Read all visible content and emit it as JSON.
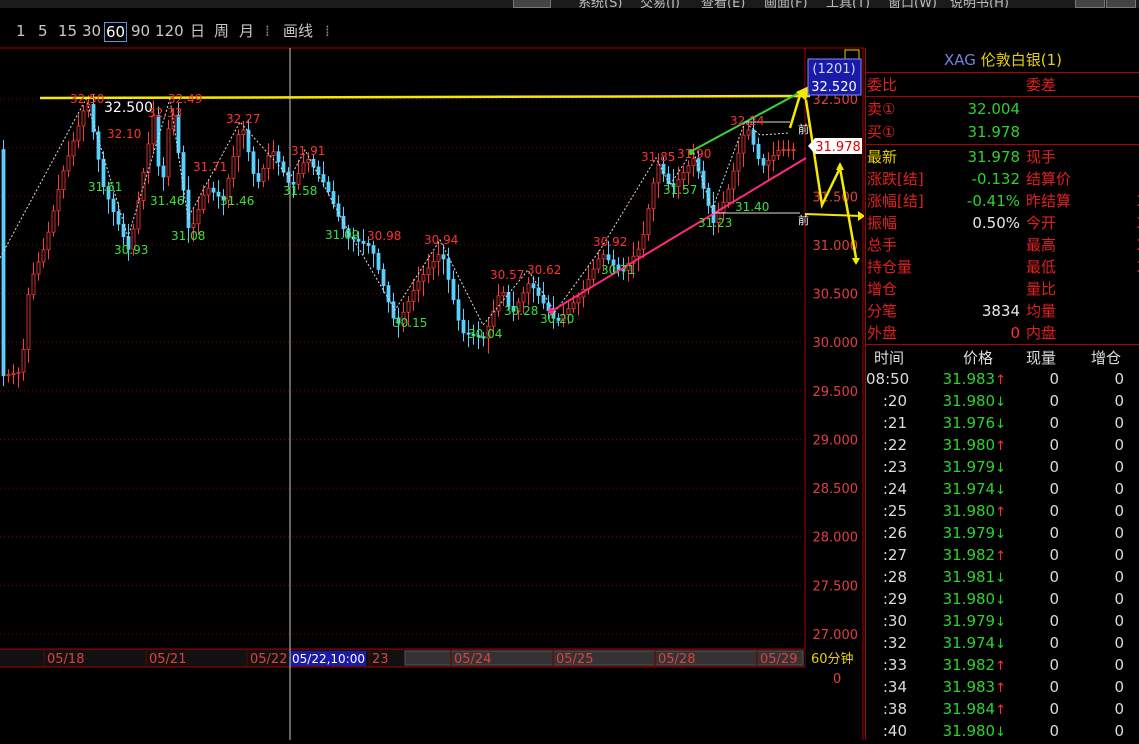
{
  "menu": {
    "items": [
      "系统(S)",
      "交易(J)",
      "查看(E)",
      "画面(F)",
      "工具(T)",
      "窗口(W)",
      "说明书(H)"
    ]
  },
  "toolbar": {
    "periods": [
      "1",
      "5",
      "15",
      "30",
      "60",
      "90",
      "120",
      "日",
      "周",
      "月"
    ],
    "selected": "60",
    "draw_label": "画线"
  },
  "chart": {
    "timeframe_label": "60分钟",
    "cursor_label": "05/22,10:00",
    "cursor_value_label": "(1201)",
    "cursor_price_label": "32.520",
    "last_price_label": "31.978",
    "y_ticks": [
      "32.500",
      "32.000",
      "31.500",
      "31.000",
      "30.500",
      "30.000",
      "29.500",
      "29.000",
      "28.500",
      "28.000",
      "27.500",
      "27.000"
    ],
    "x_ticks": [
      "05/18",
      "05/21",
      "05/22",
      "23",
      "05/24",
      "05/25",
      "05/28",
      "05/29"
    ],
    "volume_axis_label": "0",
    "resistance_label": "32.500",
    "peak_labels": [
      "32.50",
      "32.49",
      "32.33",
      "32.10",
      "32.27",
      "31.91",
      "31.71",
      "30.98",
      "30.94",
      "30.57",
      "30.62",
      "30.92",
      "31.85",
      "31.90",
      "32.24"
    ],
    "trough_labels": [
      "31.61",
      "30.93",
      "31.46",
      "31.08",
      "31.46",
      "31.58",
      "31.09",
      "30.15",
      "30.04",
      "30.28",
      "30.20",
      "30.71",
      "31.57",
      "31.23",
      "31.40"
    ],
    "misc_marks": [
      "前",
      "前"
    ],
    "colors": {
      "up": "#ff3b3b",
      "down": "#5bd0ff",
      "grid": "#7a0000",
      "green_line": "#3ad23a",
      "pink_line": "#ff2a80",
      "yellow": "#f2ea00"
    }
  },
  "quote": {
    "symbol": "XAG",
    "name": "伦敦白银",
    "suffix": "(1)",
    "wei_bi_label": "委比",
    "wei_cha_label": "委差",
    "sell_label": "卖①",
    "sell_value": "32.004",
    "buy_label": "买①",
    "buy_value": "31.978",
    "rows": [
      {
        "l1": "最新",
        "v1": "31.978",
        "l2": "现手",
        "v2": ""
      },
      {
        "l1": "涨跌[结]",
        "v1": "-0.132",
        "l2": "结算价",
        "v2": ""
      },
      {
        "l1": "涨幅[结]",
        "v1": "-0.41%",
        "l2": "昨结算",
        "v2": "3"
      },
      {
        "l1": "振幅",
        "v1": "0.50%",
        "l2": "今开",
        "v2": "3"
      },
      {
        "l1": "总手",
        "v1": "",
        "l2": "最高",
        "v2": "3"
      },
      {
        "l1": "持仓量",
        "v1": "",
        "l2": "最低",
        "v2": "3"
      },
      {
        "l1": "增仓",
        "v1": "",
        "l2": "量比",
        "v2": ""
      },
      {
        "l1": "分笔",
        "v1": "3834",
        "l2": "均量",
        "v2": ""
      },
      {
        "l1": "外盘",
        "v1": "0",
        "l2": "内盘",
        "v2": ""
      }
    ]
  },
  "ticks": {
    "headers": [
      "时间",
      "价格",
      "现量",
      "增仓"
    ],
    "rows": [
      {
        "time": "08:50",
        "price": "31.983",
        "dir": "up",
        "vol": "0",
        "oi": "0"
      },
      {
        "time": ":20",
        "price": "31.980",
        "dir": "down",
        "vol": "0",
        "oi": "0"
      },
      {
        "time": ":21",
        "price": "31.976",
        "dir": "down",
        "vol": "0",
        "oi": "0"
      },
      {
        "time": ":22",
        "price": "31.980",
        "dir": "up",
        "vol": "0",
        "oi": "0"
      },
      {
        "time": ":23",
        "price": "31.979",
        "dir": "down",
        "vol": "0",
        "oi": "0"
      },
      {
        "time": ":24",
        "price": "31.974",
        "dir": "down",
        "vol": "0",
        "oi": "0"
      },
      {
        "time": ":25",
        "price": "31.980",
        "dir": "up",
        "vol": "0",
        "oi": "0"
      },
      {
        "time": ":26",
        "price": "31.979",
        "dir": "down",
        "vol": "0",
        "oi": "0"
      },
      {
        "time": ":27",
        "price": "31.982",
        "dir": "up",
        "vol": "0",
        "oi": "0"
      },
      {
        "time": ":28",
        "price": "31.981",
        "dir": "down",
        "vol": "0",
        "oi": "0"
      },
      {
        "time": ":29",
        "price": "31.980",
        "dir": "down",
        "vol": "0",
        "oi": "0"
      },
      {
        "time": ":30",
        "price": "31.979",
        "dir": "down",
        "vol": "0",
        "oi": "0"
      },
      {
        "time": ":32",
        "price": "31.974",
        "dir": "down",
        "vol": "0",
        "oi": "0"
      },
      {
        "time": ":33",
        "price": "31.982",
        "dir": "up",
        "vol": "0",
        "oi": "0"
      },
      {
        "time": ":34",
        "price": "31.983",
        "dir": "up",
        "vol": "0",
        "oi": "0"
      },
      {
        "time": ":38",
        "price": "31.984",
        "dir": "up",
        "vol": "0",
        "oi": "0"
      },
      {
        "time": ":40",
        "price": "31.980",
        "dir": "down",
        "vol": "0",
        "oi": "0"
      }
    ]
  }
}
